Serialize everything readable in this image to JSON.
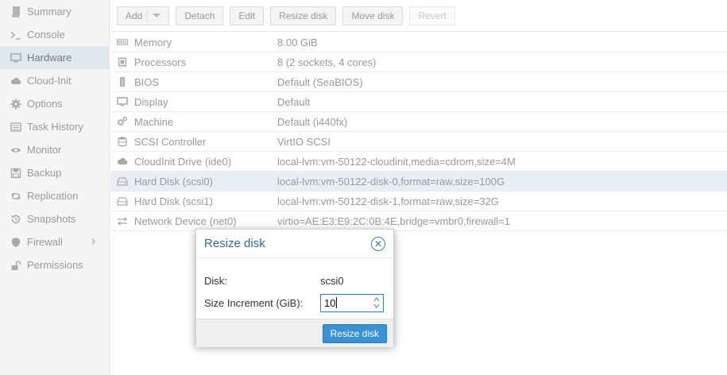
{
  "sidebar": {
    "items": [
      {
        "label": "Summary",
        "icon": "book-icon"
      },
      {
        "label": "Console",
        "icon": "terminal-icon"
      },
      {
        "label": "Hardware",
        "icon": "monitor-icon",
        "active": true
      },
      {
        "label": "Cloud-Init",
        "icon": "cloud-icon"
      },
      {
        "label": "Options",
        "icon": "gear-icon"
      },
      {
        "label": "Task History",
        "icon": "list-icon"
      },
      {
        "label": "Monitor",
        "icon": "eye-icon"
      },
      {
        "label": "Backup",
        "icon": "floppy-icon"
      },
      {
        "label": "Replication",
        "icon": "retweet-icon"
      },
      {
        "label": "Snapshots",
        "icon": "history-icon"
      },
      {
        "label": "Firewall",
        "icon": "shield-icon",
        "has_submenu": true
      },
      {
        "label": "Permissions",
        "icon": "unlock-icon"
      }
    ]
  },
  "toolbar": {
    "add_label": "Add",
    "detach_label": "Detach",
    "edit_label": "Edit",
    "resize_label": "Resize disk",
    "move_label": "Move disk",
    "revert_label": "Revert"
  },
  "hardware": {
    "rows": [
      {
        "icon": "memory-icon",
        "name": "Memory",
        "value": "8.00 GiB"
      },
      {
        "icon": "cpu-icon",
        "name": "Processors",
        "value": "8 (2 sockets, 4 cores)"
      },
      {
        "icon": "bios-icon",
        "name": "BIOS",
        "value": "Default (SeaBIOS)"
      },
      {
        "icon": "display-icon",
        "name": "Display",
        "value": "Default"
      },
      {
        "icon": "cogs-icon",
        "name": "Machine",
        "value": "Default (i440fx)"
      },
      {
        "icon": "database-icon",
        "name": "SCSI Controller",
        "value": "VirtIO SCSI"
      },
      {
        "icon": "cloud-icon",
        "name": "CloudInit Drive (ide0)",
        "value": "local-lvm:vm-50122-cloudinit,media=cdrom,size=4M"
      },
      {
        "icon": "hdd-icon",
        "name": "Hard Disk (scsi0)",
        "value": "local-lvm:vm-50122-disk-0,format=raw,size=100G",
        "selected": true
      },
      {
        "icon": "hdd-icon",
        "name": "Hard Disk (scsi1)",
        "value": "local-lvm:vm-50122-disk-1,format=raw,size=32G"
      },
      {
        "icon": "exchange-icon",
        "name": "Network Device (net0)",
        "value": "virtio=AE:E3:E9:2C:0B:4E,bridge=vmbr0,firewall=1"
      }
    ]
  },
  "dialog": {
    "title": "Resize disk",
    "disk_label": "Disk:",
    "disk_value": "scsi0",
    "increment_label": "Size Increment (GiB):",
    "increment_value": "10",
    "submit_label": "Resize disk"
  },
  "colors": {
    "accent": "#3892d3",
    "title_blue": "#2d6ca2",
    "selected_row": "#e8eef5"
  }
}
